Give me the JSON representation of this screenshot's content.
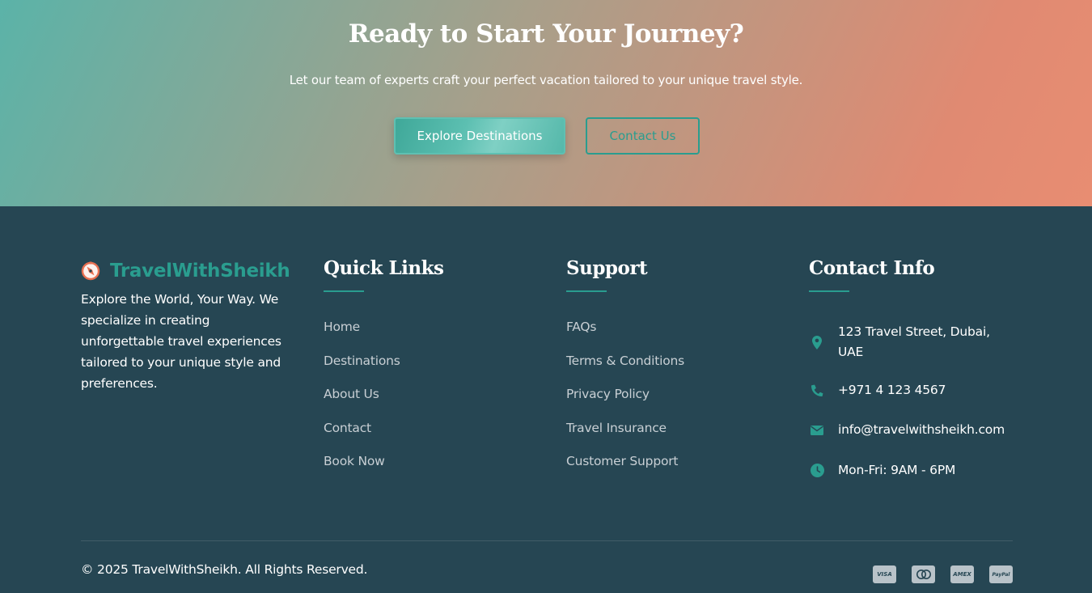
{
  "cta": {
    "title": "Ready to Start Your Journey?",
    "subtitle": "Let our team of experts craft your perfect vacation tailored to your unique travel style.",
    "primary_button": "Explore Destinations",
    "secondary_button": "Contact Us"
  },
  "footer": {
    "brand": {
      "name": "TravelWithSheikh",
      "icon": "compass-icon",
      "description": "Explore the World, Your Way. We specialize in creating unforgettable travel experiences tailored to your unique style and preferences."
    },
    "quick_links": {
      "title": "Quick Links",
      "items": [
        "Home",
        "Destinations",
        "About Us",
        "Contact",
        "Book Now"
      ]
    },
    "support": {
      "title": "Support",
      "items": [
        "FAQs",
        "Terms & Conditions",
        "Privacy Policy",
        "Travel Insurance",
        "Customer Support"
      ]
    },
    "contact": {
      "title": "Contact Info",
      "items": [
        {
          "icon": "location-pin-icon",
          "text": "123 Travel Street, Dubai, UAE"
        },
        {
          "icon": "phone-icon",
          "text": "+971 4 123 4567"
        },
        {
          "icon": "envelope-icon",
          "text": "info@travelwithsheikh.com"
        },
        {
          "icon": "clock-icon",
          "text": "Mon-Fri: 9AM - 6PM"
        }
      ]
    },
    "copyright": "© 2025 TravelWithSheikh. All Rights Reserved.",
    "payments": [
      {
        "icon": "visa-icon",
        "label": "VISA"
      },
      {
        "icon": "mastercard-icon",
        "label": ""
      },
      {
        "icon": "amex-icon",
        "label": "AMEX"
      },
      {
        "icon": "paypal-icon",
        "label": "PayPal"
      }
    ]
  },
  "colors": {
    "accent": "#2a9d8f",
    "footer_bg": "#264653",
    "gradient_start": "#5bb3a8",
    "gradient_end": "#e88d72"
  }
}
